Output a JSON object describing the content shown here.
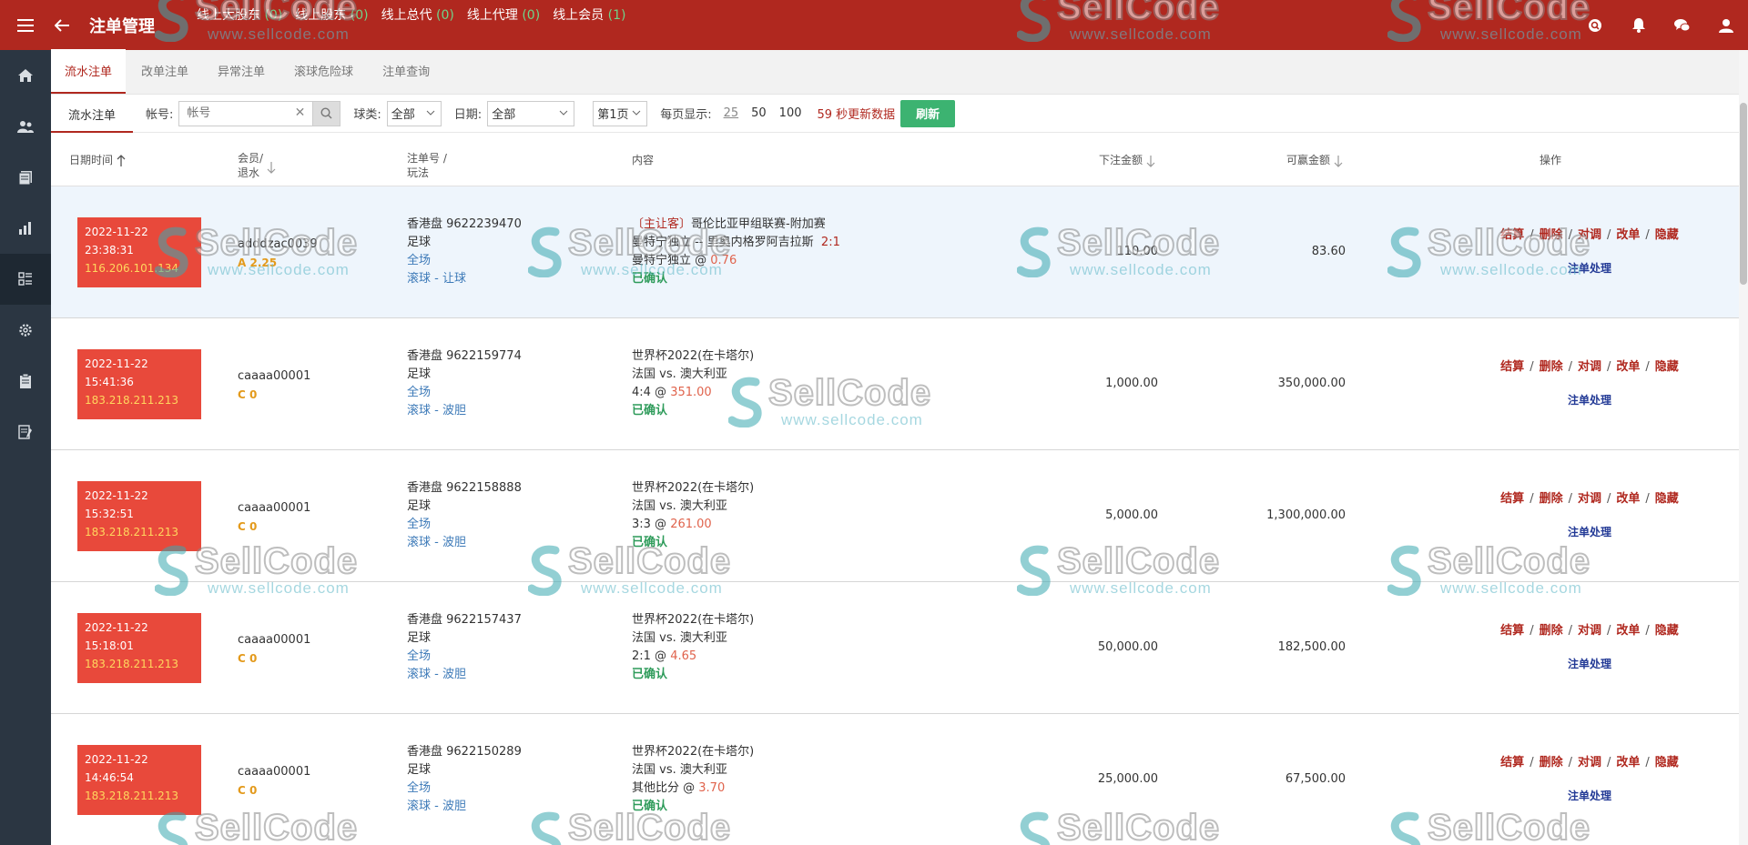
{
  "header": {
    "title": "注单管理",
    "stats": [
      {
        "label": "线上大股东",
        "count": "(0)"
      },
      {
        "label": "线上股东",
        "count": "(0)"
      },
      {
        "label": "线上总代",
        "count": "(0)"
      },
      {
        "label": "线上代理",
        "count": "(0)"
      },
      {
        "label": "线上会员",
        "count": "(1)"
      }
    ],
    "icons": [
      "search-icon",
      "bell-icon",
      "chat-icon",
      "user-icon"
    ]
  },
  "sidebar": {
    "items": [
      "home-icon",
      "users-icon",
      "documents-icon",
      "chart-icon",
      "list-icon",
      "gear-icon",
      "clipboard-icon",
      "report-icon"
    ],
    "active_index": 4
  },
  "tabs": [
    {
      "label": "流水注单",
      "active": true
    },
    {
      "label": "改单注单",
      "active": false
    },
    {
      "label": "异常注单",
      "active": false
    },
    {
      "label": "滚球危险球",
      "active": false
    },
    {
      "label": "注单查询",
      "active": false
    }
  ],
  "filter": {
    "sub_title": "流水注单",
    "account_label": "帐号:",
    "account_placeholder": "帐号",
    "ball_label": "球类:",
    "ball_value": "全部",
    "date_label": "日期:",
    "date_value": "全部",
    "page_value": "第1页",
    "per_page_label": "每页显示:",
    "per_page_options": [
      "25",
      "50",
      "100"
    ],
    "countdown": "59 秒更新数据",
    "refresh_label": "刷新"
  },
  "table": {
    "headers": {
      "datetime": "日期时间",
      "member_line1": "会员/",
      "member_line2": "退水",
      "bet_line1": "注单号 /",
      "bet_line2": "玩法",
      "content": "内容",
      "stake": "下注金额",
      "win": "可赢金额",
      "ops": "操作"
    },
    "rows": [
      {
        "date": "2022-11-22",
        "time": "23:38:31",
        "ip": "116.206.101.134",
        "member": "adddzac0039",
        "rebate": "A 2.25",
        "bet_no": "香港盘 9622239470",
        "sport": "足球",
        "period": "全场",
        "play": "滚球 - 让球",
        "tag": "〔主让客〕",
        "league": "哥伦比亚甲组联赛-附加赛",
        "match_line": "曼特宁独立 -- 里奥内格罗阿吉拉斯",
        "handicap": "2:1",
        "pick": "曼特宁独立 @",
        "odds": "0.76",
        "status": "已确认",
        "stake": "110.00",
        "win": "83.60",
        "highlight": true
      },
      {
        "date": "2022-11-22",
        "time": "15:41:36",
        "ip": "183.218.211.213",
        "member": "caaaa00001",
        "rebate": "C 0",
        "bet_no": "香港盘 9622159774",
        "sport": "足球",
        "period": "全场",
        "play": "滚球 - 波胆",
        "tag": "",
        "league": "世界杯2022(在卡塔尔)",
        "match_line": "法国  vs.  澳大利亚",
        "handicap": "",
        "pick": "4:4 @",
        "odds": "351.00",
        "status": "已确认",
        "stake": "1,000.00",
        "win": "350,000.00",
        "highlight": false
      },
      {
        "date": "2022-11-22",
        "time": "15:32:51",
        "ip": "183.218.211.213",
        "member": "caaaa00001",
        "rebate": "C 0",
        "bet_no": "香港盘 9622158888",
        "sport": "足球",
        "period": "全场",
        "play": "滚球 - 波胆",
        "tag": "",
        "league": "世界杯2022(在卡塔尔)",
        "match_line": "法国  vs.  澳大利亚",
        "handicap": "",
        "pick": "3:3 @",
        "odds": "261.00",
        "status": "已确认",
        "stake": "5,000.00",
        "win": "1,300,000.00",
        "highlight": false
      },
      {
        "date": "2022-11-22",
        "time": "15:18:01",
        "ip": "183.218.211.213",
        "member": "caaaa00001",
        "rebate": "C 0",
        "bet_no": "香港盘 9622157437",
        "sport": "足球",
        "period": "全场",
        "play": "滚球 - 波胆",
        "tag": "",
        "league": "世界杯2022(在卡塔尔)",
        "match_line": "法国  vs.  澳大利亚",
        "handicap": "",
        "pick": "2:1 @",
        "odds": "4.65",
        "status": "已确认",
        "stake": "50,000.00",
        "win": "182,500.00",
        "highlight": false
      },
      {
        "date": "2022-11-22",
        "time": "14:46:54",
        "ip": "183.218.211.213",
        "member": "caaaa00001",
        "rebate": "C 0",
        "bet_no": "香港盘 9622150289",
        "sport": "足球",
        "period": "全场",
        "play": "滚球 - 波胆",
        "tag": "",
        "league": "世界杯2022(在卡塔尔)",
        "match_line": "法国  vs.  澳大利亚",
        "handicap": "",
        "pick": "其他比分 @",
        "odds": "3.70",
        "status": "已确认",
        "stake": "25,000.00",
        "win": "67,500.00",
        "highlight": false
      }
    ],
    "ops": [
      "结算",
      "删除",
      "对调",
      "改单",
      "隐藏"
    ],
    "handle_label": "注单处理"
  },
  "watermark": {
    "brand": "SellCode",
    "url": "www.sellcode.com"
  },
  "colors": {
    "brand_red": "#b0281f",
    "date_box": "#e8493b",
    "ip_yellow": "#ffd75e",
    "confirm_green": "#2e9b5a",
    "refresh_green": "#3cb371",
    "sidebar": "#2b3642"
  }
}
